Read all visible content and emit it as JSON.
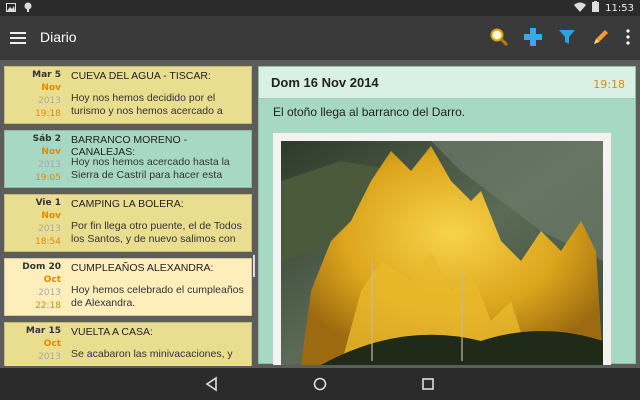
{
  "status": {
    "time": "11:53",
    "icons": [
      "image-icon",
      "notification-icon",
      "wifi-icon",
      "battery-icon"
    ]
  },
  "appbar": {
    "title": "Diario",
    "actions": [
      "search-icon",
      "add-icon",
      "filter-icon",
      "edit-icon",
      "overflow-menu-icon"
    ]
  },
  "entries": [
    {
      "day": "Mar 5",
      "month": "Nov",
      "year": "2013",
      "time": "19:18",
      "title": "CUEVA DEL AGUA - TISCAR:",
      "text": "Hoy nos hemos decidido por el turismo y nos hemos acercado a",
      "color": "yellow"
    },
    {
      "day": "Sáb 2",
      "month": "Nov",
      "year": "2013",
      "time": "19:05",
      "title": "BARRANCO MORENO - CANALEJAS:",
      "text": "Hoy nos hemos acercado hasta la Sierra de Castril para hacer esta",
      "color": "green"
    },
    {
      "day": "Vie 1",
      "month": "Nov",
      "year": "2013",
      "time": "18:54",
      "title": "CAMPING LA BOLERA:",
      "text": "Por fin llega otro puente, el de Todos los Santos, y de nuevo salimos con",
      "color": "yellow"
    },
    {
      "day": "Dom 20",
      "month": "Oct",
      "year": "2013",
      "time": "22:18",
      "title": "CUMPLEAÑOS ALEXANDRA:",
      "text": "Hoy hemos celebrado el cumpleaños de Alexandra.",
      "color": "selected"
    },
    {
      "day": "Mar 15",
      "month": "Oct",
      "year": "2013",
      "time": "",
      "title": "VUELTA A CASA:",
      "text": "Se acabaron las minivacaciones, y",
      "color": "yellow"
    }
  ],
  "detail": {
    "date": "Dom 16 Nov 2014",
    "time": "19:18",
    "text": "El otoño llega al barranco del Darro."
  },
  "colors": {
    "accent": "#e08a00",
    "yellow": "#e9dd8f",
    "green": "#a6d8c3"
  }
}
